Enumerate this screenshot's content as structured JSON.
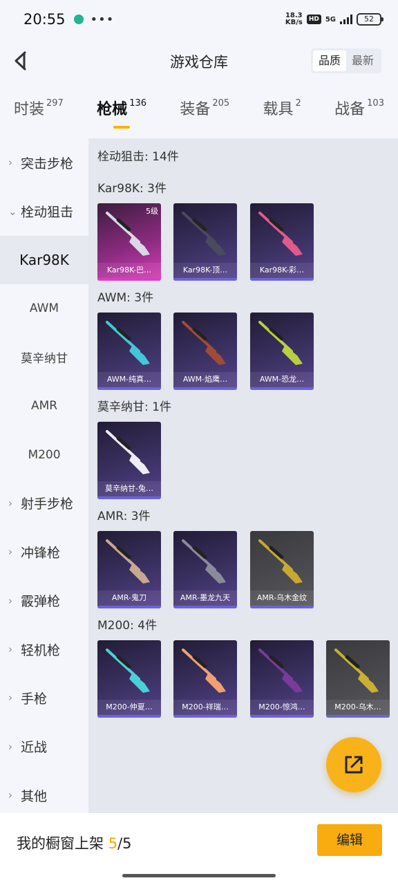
{
  "status_bar": {
    "time": "20:55",
    "dots": "•••",
    "speed_top": "18.3",
    "speed_bottom": "KB/s",
    "hd": "HD",
    "network": "5G",
    "battery": "52"
  },
  "header": {
    "title": "游戏仓库",
    "sort_options": [
      "品质",
      "最新"
    ],
    "sort_selected": "品质"
  },
  "tabs": [
    {
      "label": "时装",
      "count": "297"
    },
    {
      "label": "枪械",
      "count": "136",
      "active": true
    },
    {
      "label": "装备",
      "count": "205"
    },
    {
      "label": "载具",
      "count": "2"
    },
    {
      "label": "战备",
      "count": "103"
    }
  ],
  "sidebar": {
    "items": [
      {
        "label": "突击步枪",
        "chevron": "›"
      },
      {
        "label": "栓动狙击",
        "chevron": "⌄"
      },
      {
        "label": "Kar98K",
        "sub": true,
        "active": true
      },
      {
        "label": "AWM",
        "sub": true
      },
      {
        "label": "莫辛纳甘",
        "sub": true
      },
      {
        "label": "AMR",
        "sub": true
      },
      {
        "label": "M200",
        "sub": true
      },
      {
        "label": "射手步枪",
        "chevron": "›"
      },
      {
        "label": "冲锋枪",
        "chevron": "›"
      },
      {
        "label": "霰弹枪",
        "chevron": "›"
      },
      {
        "label": "轻机枪",
        "chevron": "›"
      },
      {
        "label": "手枪",
        "chevron": "›"
      },
      {
        "label": "近战",
        "chevron": "›"
      },
      {
        "label": "其他",
        "chevron": "›"
      }
    ]
  },
  "main": {
    "heading": "栓动狙击: 14件",
    "groups": [
      {
        "title": "Kar98K: 3件",
        "items": [
          {
            "name": "Kar98K-巴…",
            "style": "pink",
            "level": "5级",
            "gun_color": "#d9d9e6"
          },
          {
            "name": "Kar98K-顶…",
            "style": "purple",
            "gun_color": "#4a4a5e"
          },
          {
            "name": "Kar98K-彩…",
            "style": "purple",
            "gun_color": "#e05a8a"
          }
        ]
      },
      {
        "title": "AWM: 3件",
        "items": [
          {
            "name": "AWM-纯真…",
            "style": "purple",
            "gun_color": "#44c6d8"
          },
          {
            "name": "AWM-焰鹰…",
            "style": "purple",
            "gun_color": "#a04a38"
          },
          {
            "name": "AWM-恐龙…",
            "style": "purple",
            "gun_color": "#b8d040"
          }
        ]
      },
      {
        "title": "莫辛纳甘: 1件",
        "items": [
          {
            "name": "莫辛纳甘-兔…",
            "style": "purple",
            "gun_color": "#eeeef6"
          }
        ]
      },
      {
        "title": "AMR: 3件",
        "items": [
          {
            "name": "AMR-鬼刀",
            "style": "purple",
            "gun_color": "#c8a890"
          },
          {
            "name": "AMR-墨龙九天",
            "style": "purple",
            "gun_color": "#8a8a9a"
          },
          {
            "name": "AMR-乌木金纹",
            "style": "grey",
            "gun_color": "#c9a830"
          }
        ]
      },
      {
        "title": "M200: 4件",
        "items": [
          {
            "name": "M200-仲夏…",
            "style": "purple",
            "gun_color": "#4ad0d8"
          },
          {
            "name": "M200-祥瑞…",
            "style": "purple",
            "gun_color": "#f0a070"
          },
          {
            "name": "M200-惊鸿…",
            "style": "purple",
            "gun_color": "#7a3a9a"
          },
          {
            "name": "M200-乌木…",
            "style": "grey",
            "gun_color": "#c9b030"
          }
        ]
      }
    ]
  },
  "bottom_bar": {
    "showcase_label": "我的橱窗上架",
    "showcase_current": "5",
    "showcase_sep": "/",
    "showcase_total": "5",
    "edit_label": "编辑"
  },
  "colors": {
    "accent": "#f8ac10",
    "sidebar_active_bg": "#e6e9ef",
    "content_bg": "#e4e7ed"
  }
}
